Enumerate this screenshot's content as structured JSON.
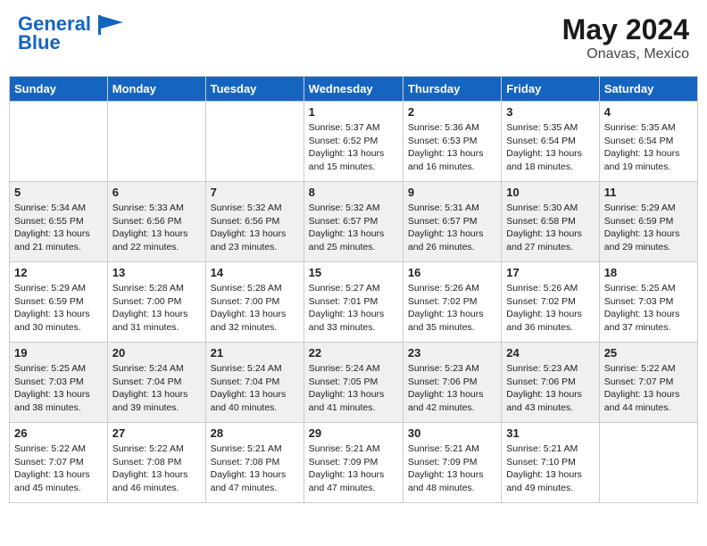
{
  "header": {
    "logo_line1": "General",
    "logo_line2": "Blue",
    "month_year": "May 2024",
    "location": "Onavas, Mexico"
  },
  "days_of_week": [
    "Sunday",
    "Monday",
    "Tuesday",
    "Wednesday",
    "Thursday",
    "Friday",
    "Saturday"
  ],
  "weeks": [
    {
      "row_style": "row-normal",
      "days": [
        {
          "num": "",
          "info": ""
        },
        {
          "num": "",
          "info": ""
        },
        {
          "num": "",
          "info": ""
        },
        {
          "num": "1",
          "info": "Sunrise: 5:37 AM\nSunset: 6:52 PM\nDaylight: 13 hours\nand 15 minutes."
        },
        {
          "num": "2",
          "info": "Sunrise: 5:36 AM\nSunset: 6:53 PM\nDaylight: 13 hours\nand 16 minutes."
        },
        {
          "num": "3",
          "info": "Sunrise: 5:35 AM\nSunset: 6:54 PM\nDaylight: 13 hours\nand 18 minutes."
        },
        {
          "num": "4",
          "info": "Sunrise: 5:35 AM\nSunset: 6:54 PM\nDaylight: 13 hours\nand 19 minutes."
        }
      ]
    },
    {
      "row_style": "row-alt",
      "days": [
        {
          "num": "5",
          "info": "Sunrise: 5:34 AM\nSunset: 6:55 PM\nDaylight: 13 hours\nand 21 minutes."
        },
        {
          "num": "6",
          "info": "Sunrise: 5:33 AM\nSunset: 6:56 PM\nDaylight: 13 hours\nand 22 minutes."
        },
        {
          "num": "7",
          "info": "Sunrise: 5:32 AM\nSunset: 6:56 PM\nDaylight: 13 hours\nand 23 minutes."
        },
        {
          "num": "8",
          "info": "Sunrise: 5:32 AM\nSunset: 6:57 PM\nDaylight: 13 hours\nand 25 minutes."
        },
        {
          "num": "9",
          "info": "Sunrise: 5:31 AM\nSunset: 6:57 PM\nDaylight: 13 hours\nand 26 minutes."
        },
        {
          "num": "10",
          "info": "Sunrise: 5:30 AM\nSunset: 6:58 PM\nDaylight: 13 hours\nand 27 minutes."
        },
        {
          "num": "11",
          "info": "Sunrise: 5:29 AM\nSunset: 6:59 PM\nDaylight: 13 hours\nand 29 minutes."
        }
      ]
    },
    {
      "row_style": "row-normal",
      "days": [
        {
          "num": "12",
          "info": "Sunrise: 5:29 AM\nSunset: 6:59 PM\nDaylight: 13 hours\nand 30 minutes."
        },
        {
          "num": "13",
          "info": "Sunrise: 5:28 AM\nSunset: 7:00 PM\nDaylight: 13 hours\nand 31 minutes."
        },
        {
          "num": "14",
          "info": "Sunrise: 5:28 AM\nSunset: 7:00 PM\nDaylight: 13 hours\nand 32 minutes."
        },
        {
          "num": "15",
          "info": "Sunrise: 5:27 AM\nSunset: 7:01 PM\nDaylight: 13 hours\nand 33 minutes."
        },
        {
          "num": "16",
          "info": "Sunrise: 5:26 AM\nSunset: 7:02 PM\nDaylight: 13 hours\nand 35 minutes."
        },
        {
          "num": "17",
          "info": "Sunrise: 5:26 AM\nSunset: 7:02 PM\nDaylight: 13 hours\nand 36 minutes."
        },
        {
          "num": "18",
          "info": "Sunrise: 5:25 AM\nSunset: 7:03 PM\nDaylight: 13 hours\nand 37 minutes."
        }
      ]
    },
    {
      "row_style": "row-alt",
      "days": [
        {
          "num": "19",
          "info": "Sunrise: 5:25 AM\nSunset: 7:03 PM\nDaylight: 13 hours\nand 38 minutes."
        },
        {
          "num": "20",
          "info": "Sunrise: 5:24 AM\nSunset: 7:04 PM\nDaylight: 13 hours\nand 39 minutes."
        },
        {
          "num": "21",
          "info": "Sunrise: 5:24 AM\nSunset: 7:04 PM\nDaylight: 13 hours\nand 40 minutes."
        },
        {
          "num": "22",
          "info": "Sunrise: 5:24 AM\nSunset: 7:05 PM\nDaylight: 13 hours\nand 41 minutes."
        },
        {
          "num": "23",
          "info": "Sunrise: 5:23 AM\nSunset: 7:06 PM\nDaylight: 13 hours\nand 42 minutes."
        },
        {
          "num": "24",
          "info": "Sunrise: 5:23 AM\nSunset: 7:06 PM\nDaylight: 13 hours\nand 43 minutes."
        },
        {
          "num": "25",
          "info": "Sunrise: 5:22 AM\nSunset: 7:07 PM\nDaylight: 13 hours\nand 44 minutes."
        }
      ]
    },
    {
      "row_style": "row-normal",
      "days": [
        {
          "num": "26",
          "info": "Sunrise: 5:22 AM\nSunset: 7:07 PM\nDaylight: 13 hours\nand 45 minutes."
        },
        {
          "num": "27",
          "info": "Sunrise: 5:22 AM\nSunset: 7:08 PM\nDaylight: 13 hours\nand 46 minutes."
        },
        {
          "num": "28",
          "info": "Sunrise: 5:21 AM\nSunset: 7:08 PM\nDaylight: 13 hours\nand 47 minutes."
        },
        {
          "num": "29",
          "info": "Sunrise: 5:21 AM\nSunset: 7:09 PM\nDaylight: 13 hours\nand 47 minutes."
        },
        {
          "num": "30",
          "info": "Sunrise: 5:21 AM\nSunset: 7:09 PM\nDaylight: 13 hours\nand 48 minutes."
        },
        {
          "num": "31",
          "info": "Sunrise: 5:21 AM\nSunset: 7:10 PM\nDaylight: 13 hours\nand 49 minutes."
        },
        {
          "num": "",
          "info": ""
        }
      ]
    }
  ]
}
